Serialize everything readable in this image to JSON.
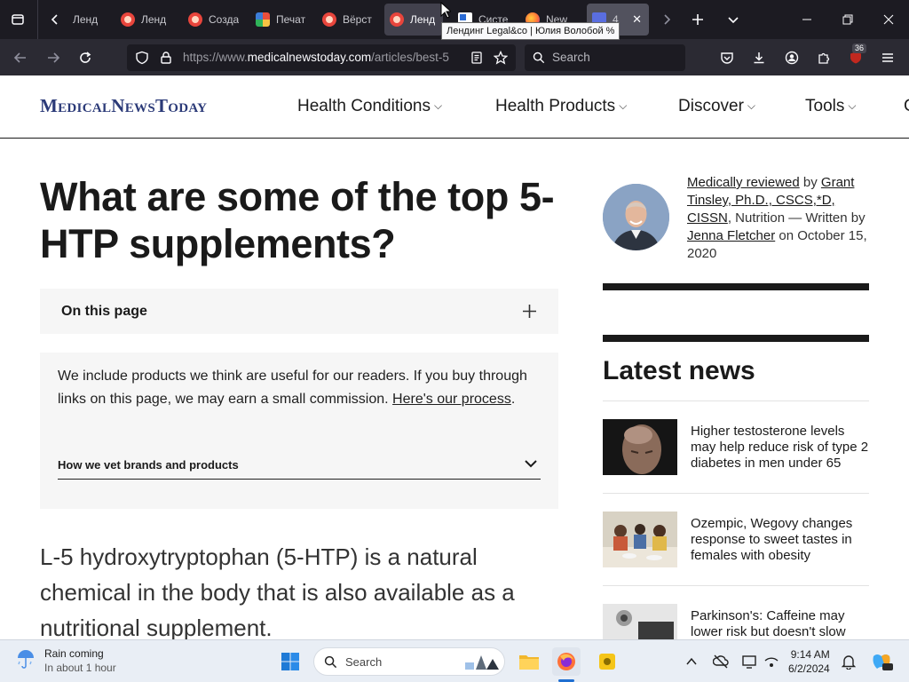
{
  "browser": {
    "tabs": [
      {
        "label": "Ленд",
        "icon": "red-circle-favicon",
        "state": "normal"
      },
      {
        "label": "Ленд",
        "icon": "red-circle-favicon",
        "state": "normal"
      },
      {
        "label": "Созда",
        "icon": "red-circle-favicon",
        "state": "normal"
      },
      {
        "label": "Печат",
        "icon": "multicolor-favicon",
        "state": "normal"
      },
      {
        "label": "Вёрст",
        "icon": "red-circle-favicon",
        "state": "normal"
      },
      {
        "label": "Ленд",
        "icon": "red-circle-favicon",
        "state": "active"
      },
      {
        "label": "Систе",
        "icon": "square-favicon",
        "state": "normal"
      },
      {
        "label": "New",
        "icon": "firefox-favicon",
        "state": "normal"
      },
      {
        "label": "4",
        "icon": "blue-favicon",
        "state": "selected"
      }
    ],
    "tooltip": "Лендинг Legal&co | Юлия Волобой %",
    "url_prefix": "https://www.",
    "url_domain": "medicalnewstoday.com",
    "url_path": "/articles/best-5",
    "search_placeholder": "Search",
    "extension_badge": "36"
  },
  "site": {
    "logo": "MedicalNewsToday",
    "nav": [
      "Health Conditions",
      "Health Products",
      "Discover",
      "Tools",
      "C"
    ]
  },
  "article": {
    "title": "What are some of the top 5-HTP supplements?",
    "on_this_page": "On this page",
    "disclosure_text": "We include products we think are useful for our readers. If you buy through links on this page, we may earn a small commission. ",
    "disclosure_link": "Here's our process",
    "disclosure_end": ".",
    "vet_label": "How we vet brands and products",
    "lede": "L-5 hydroxytryptophan (5-HTP) is a natural chemical in the body that is also available as a nutritional supplement."
  },
  "byline": {
    "reviewed_link": "Medically reviewed",
    "by": " by ",
    "reviewer": "Grant Tinsley, Ph.D., CSCS,*D, CISSN",
    "reviewer_field": ", Nutrition — Written by ",
    "author": "Jenna Fletcher",
    "date_prefix": " on ",
    "date": "October 15, 2020"
  },
  "latest": {
    "heading": "Latest news",
    "items": [
      {
        "title": "Higher testosterone levels may help reduce risk of type 2 diabetes in men under 65"
      },
      {
        "title": "Ozempic, Wegovy changes response to sweet tastes in females with obesity"
      },
      {
        "title": "Parkinson's: Caffeine may lower risk but doesn't slow"
      }
    ]
  },
  "taskbar": {
    "weather_title": "Rain coming",
    "weather_sub": "In about 1 hour",
    "search": "Search",
    "time": "9:14 AM",
    "date": "6/2/2024"
  }
}
